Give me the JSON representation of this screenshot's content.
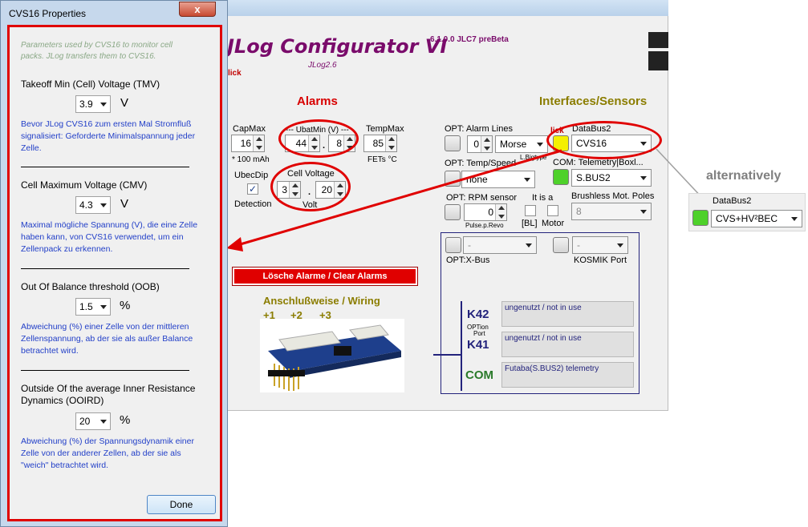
{
  "main": {
    "title": "JLog Configurator VI",
    "version": "6.1.0.0 JLC7 preBeta",
    "subtitle": "JLog2.6",
    "click_label": "lick",
    "alarms_heading": "Alarms",
    "interfaces_heading": "Interfaces/Sensors",
    "capmax": {
      "label": "CapMax",
      "value": "16",
      "unit": "* 100 mAh"
    },
    "ubatmin": {
      "label": "--- UbatMin (V) ---",
      "int": "44",
      "dec": "8"
    },
    "tempmax": {
      "label": "TempMax",
      "value": "85",
      "unit": "FETs °C"
    },
    "ubecdip": {
      "label": "UbecDip",
      "detection": "Detection"
    },
    "cell_voltage": {
      "label": "Cell Voltage",
      "int": "3",
      "dec": "20",
      "unit": "Volt"
    },
    "clear_button": "Lösche Alarme / Clear Alarms",
    "wiring": {
      "title": "Anschlußweise / Wiring",
      "p1": "+1",
      "p2": "+2",
      "p3": "+3"
    },
    "alarm_lines": {
      "label": "OPT: Alarm Lines",
      "value": "0",
      "mode": "Morse",
      "note": "L.Bigtype"
    },
    "temp_speed": {
      "label": "OPT: Temp/Speed",
      "value": "none"
    },
    "rpm": {
      "label": "OPT: RPM sensor",
      "value": "0",
      "note": "Pulse.p.Revo",
      "itisa": "It is a",
      "bl": "[BL]",
      "motor": "Motor"
    },
    "databus": {
      "click": "lick",
      "label": "DataBus2",
      "value": "CVS16"
    },
    "telemetry": {
      "label": "COM: Telemetry|Boxl...",
      "value": "S.BUS2"
    },
    "poles": {
      "label": "Brushless Mot. Poles",
      "value": "8"
    },
    "xbus": {
      "label": "OPT:X-Bus",
      "value": "-"
    },
    "kosmik": {
      "label": "KOSMIK Port",
      "value": "-"
    },
    "ports": {
      "k42": "K42",
      "option": "OPTion",
      "port": "Port",
      "k41": "K41",
      "com": "COM",
      "slot1": "ungenutzt / not in use",
      "slot2": "ungenutzt / not in use",
      "slot3": "Futaba(S.BUS2) telemetry"
    }
  },
  "dialog": {
    "title": "CVS16 Properties",
    "close": "x",
    "intro": "Parameters used by CVS16 to monitor cell packs. JLog transfers them to CVS16.",
    "tmv": {
      "head": "Takeoff Min (Cell) Voltage (TMV)",
      "value": "3.9",
      "unit": "V",
      "desc": "Bevor JLog CVS16 zum ersten Mal Stromfluß signalisiert: Geforderte Minimalspannung jeder Zelle."
    },
    "cmv": {
      "head": "Cell Maximum Voltage (CMV)",
      "value": "4.3",
      "unit": "V",
      "desc": "Maximal mögliche Spannung (V), die eine Zelle haben kann, von CVS16 verwendet, um ein Zellenpack zu erkennen."
    },
    "oob": {
      "head": "Out Of Balance threshold (OOB)",
      "value": "1.5",
      "unit": "%",
      "desc": "Abweichung (%) einer Zelle von der mittleren Zellenspannung, ab der sie als außer Balance betrachtet wird."
    },
    "ooird": {
      "head": "Outside Of the average Inner Resistance Dynamics (OOIRD)",
      "value": "20",
      "unit": "%",
      "desc": "Abweichung (%) der Spannungsdynamik einer Zelle von der anderer Zellen, ab der sie als \"weich\" betrachtet wird."
    },
    "done": "Done"
  },
  "alternative": {
    "label": "alternatively",
    "databus_label": "DataBus2",
    "value": "CVS+HV²BEC"
  },
  "colors": {
    "annotation": "#e00000",
    "title": "#7a0b6b",
    "interfaces": "#8b7d00"
  }
}
